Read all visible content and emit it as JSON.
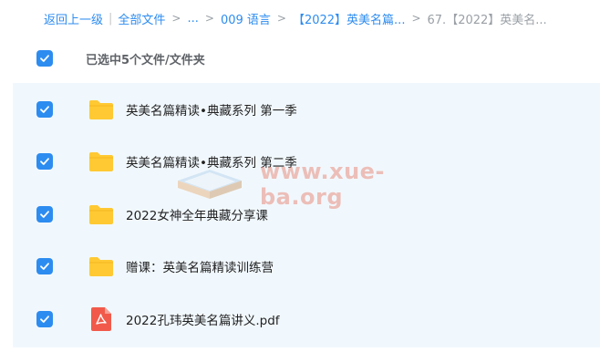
{
  "breadcrumb": {
    "back": "返回上一级",
    "separator_bar": "|",
    "all_files": "全部文件",
    "ellipsis": "...",
    "folder1": "009 语言",
    "folder2": "【2022】英美名篇...",
    "current": "67.【2022】英美名...",
    "arrow": ">"
  },
  "selection": {
    "text": "已选中5个文件/文件夹"
  },
  "files": [
    {
      "name": "英美名篇精读•典藏系列 第一季",
      "type": "folder"
    },
    {
      "name": "英美名篇精读•典藏系列 第二季",
      "type": "folder"
    },
    {
      "name": "2022女神全年典藏分享课",
      "type": "folder"
    },
    {
      "name": "赠课：英美名篇精读训练营",
      "type": "folder"
    },
    {
      "name": "2022孔玮英美名篇讲义.pdf",
      "type": "pdf"
    }
  ],
  "watermark": {
    "text": "www.xue-ba.org"
  },
  "colors": {
    "accent": "#2d8cf0",
    "folder": "#ffc933",
    "pdf": "#f15a4a",
    "list_bg": "#f1f8fd"
  }
}
